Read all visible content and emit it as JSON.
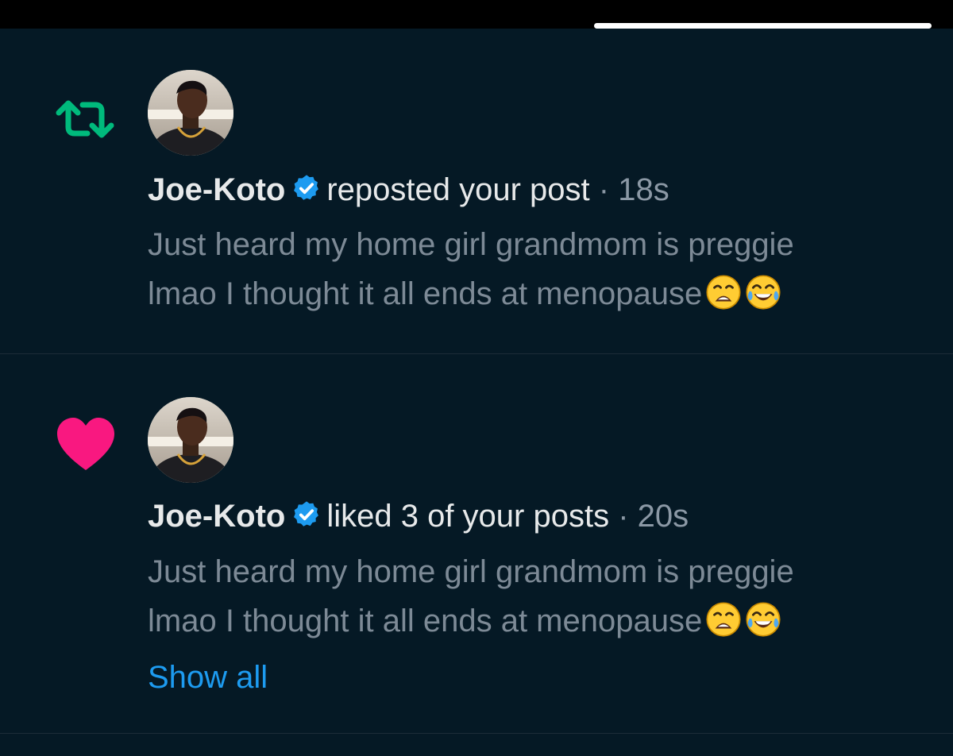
{
  "notifications": [
    {
      "kind": "repost",
      "kind_icon": "repost-icon",
      "kind_color": "#00ba7c",
      "author": "Joe-Koto",
      "verified": true,
      "action": "reposted your post",
      "dot": "·",
      "time": "18s",
      "post_line1": "Just heard my home girl grandmom is preggie",
      "post_line2": "lmao I thought it all ends at menopause",
      "emojis": [
        "weary-face-emoji",
        "tears-of-joy-emoji"
      ]
    },
    {
      "kind": "like",
      "kind_icon": "heart-icon",
      "kind_color": "#f91880",
      "author": "Joe-Koto",
      "verified": true,
      "action": "liked 3 of your posts",
      "dot": "·",
      "time": "20s",
      "post_line1": "Just heard my home girl grandmom is preggie",
      "post_line2": "lmao I thought it all ends at menopause",
      "emojis": [
        "weary-face-emoji",
        "tears-of-joy-emoji"
      ],
      "show_all_label": "Show all"
    }
  ],
  "colors": {
    "background": "#051925",
    "primary_text": "#e7e9ea",
    "secondary_text": "#7d8a96",
    "link": "#1d9bf0",
    "verified": "#1d9bf0"
  }
}
